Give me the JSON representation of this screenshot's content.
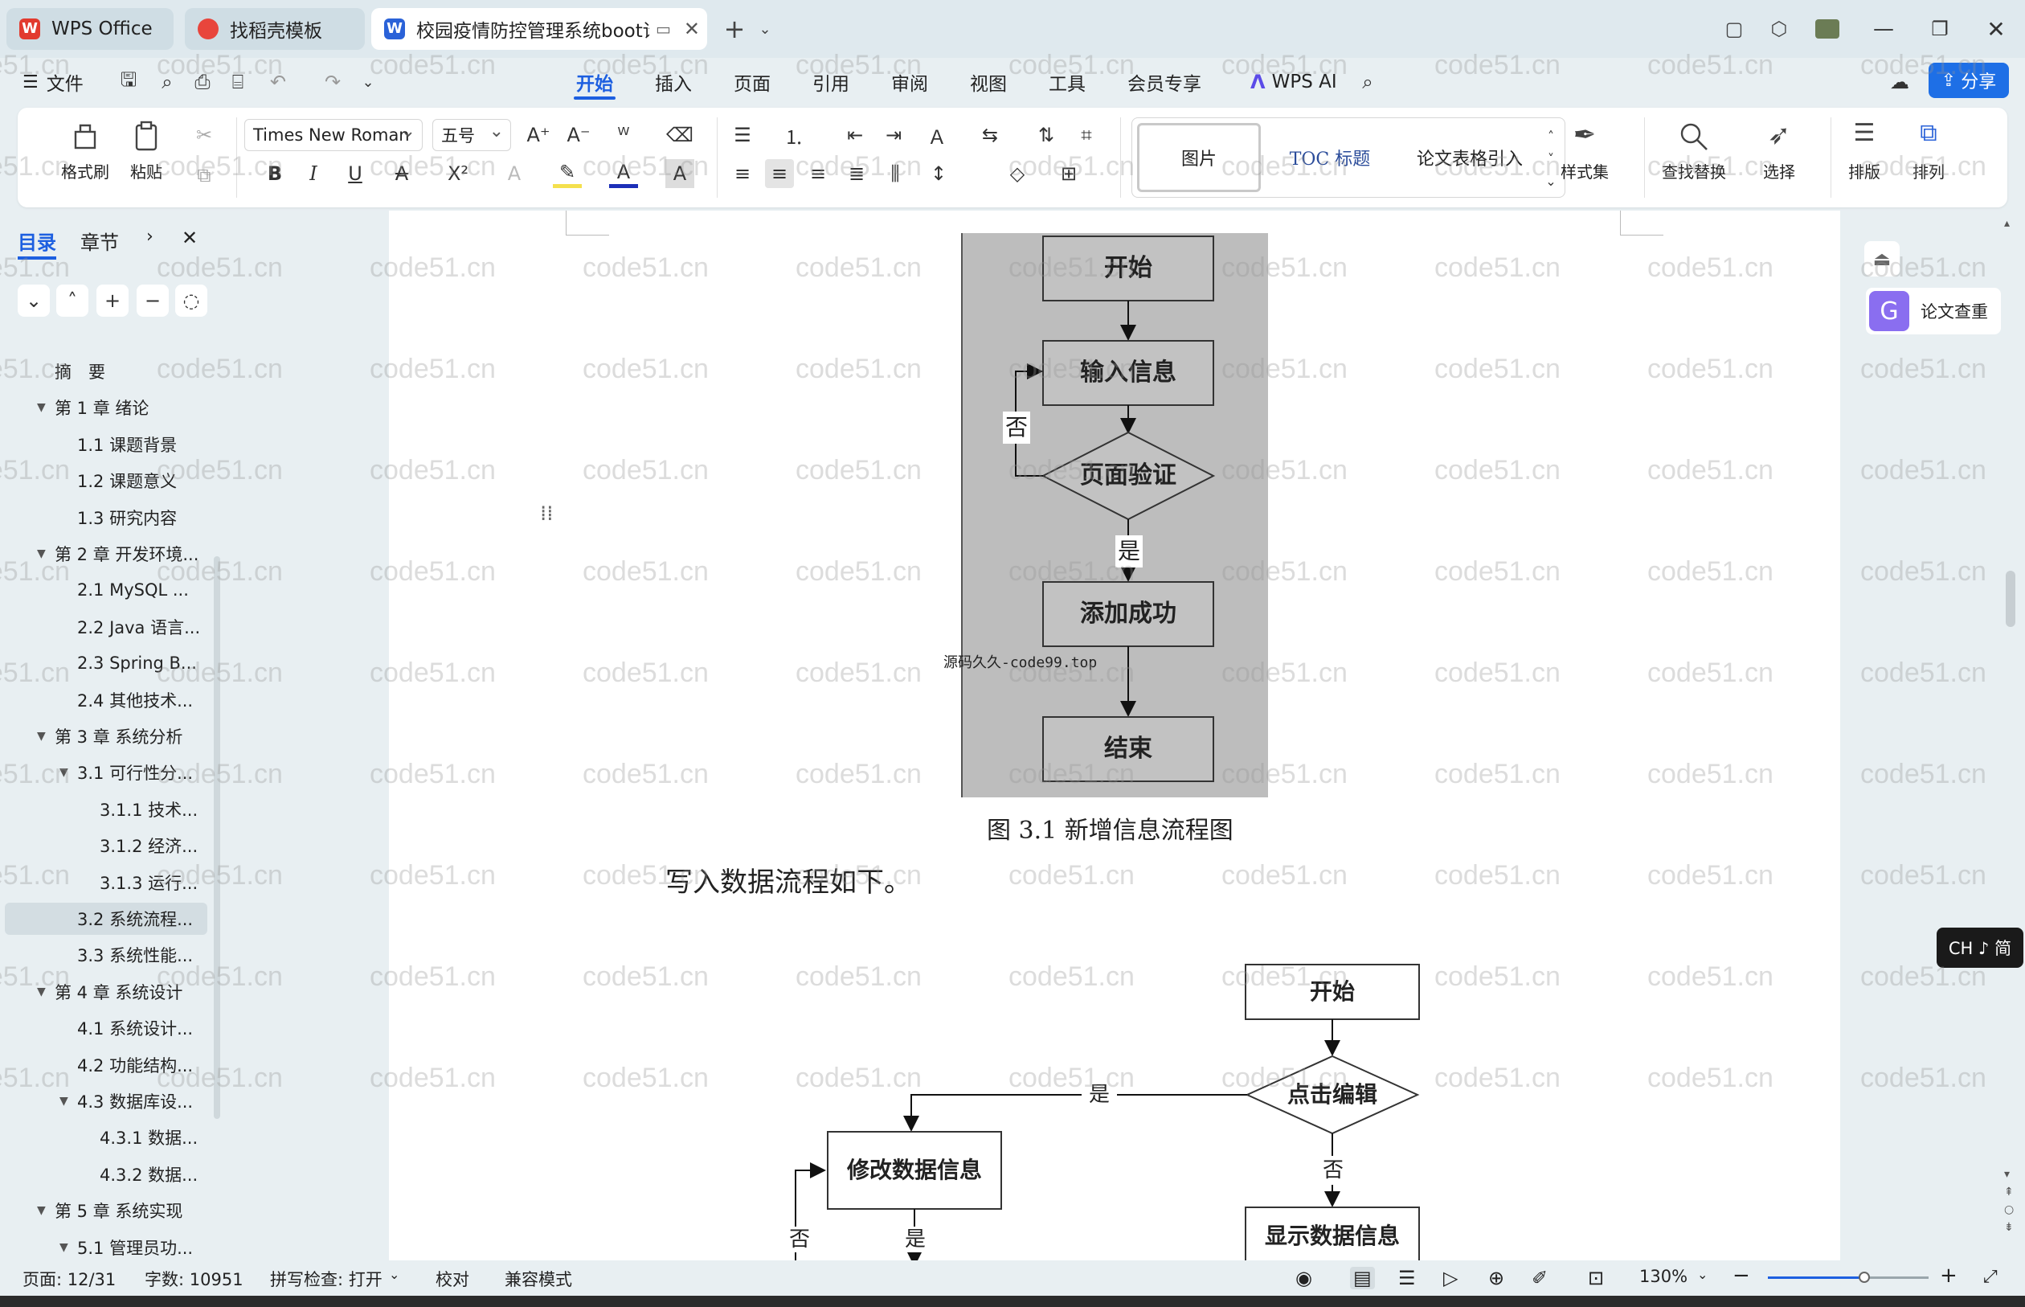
{
  "tabs": {
    "wps": "WPS Office",
    "template": "找稻壳模板",
    "document": "校园疫情防控管理系统boot论"
  },
  "menu": {
    "file": "文件",
    "home": "开始",
    "insert": "插入",
    "page": "页面",
    "reference": "引用",
    "review": "审阅",
    "view": "视图",
    "tools": "工具",
    "member": "会员专享",
    "ai": "WPS AI",
    "share": "分享"
  },
  "ribbon": {
    "format_painter": "格式刷",
    "paste": "粘贴",
    "font_name": "Times New Roman",
    "font_size": "五号",
    "style_picture": "图片",
    "style_toc": "TOC 标题",
    "style_paper": "论文表格引入",
    "style_set": "样式集",
    "find_replace": "查找替换",
    "select": "选择",
    "layout": "排版",
    "arrange": "排列"
  },
  "nav": {
    "tab_toc": "目录",
    "tab_chapter": "章节",
    "items": [
      {
        "label": "摘　要"
      },
      {
        "label": "第 1 章  绪论"
      },
      {
        "label": "1.1  课题背景"
      },
      {
        "label": "1.2  课题意义"
      },
      {
        "label": "1.3  研究内容"
      },
      {
        "label": "第 2 章  开发环境..."
      },
      {
        "label": "2.1  MySQL ..."
      },
      {
        "label": "2.2 Java 语言..."
      },
      {
        "label": "2.3 Spring B..."
      },
      {
        "label": "2.4  其他技术..."
      },
      {
        "label": "第 3 章  系统分析"
      },
      {
        "label": "3.1 可行性分..."
      },
      {
        "label": "3.1.1 技术..."
      },
      {
        "label": "3.1.2 经济..."
      },
      {
        "label": "3.1.3 运行..."
      },
      {
        "label": "3.2 系统流程..."
      },
      {
        "label": "3.3 系统性能..."
      },
      {
        "label": "第 4 章  系统设计"
      },
      {
        "label": "4.1  系统设计..."
      },
      {
        "label": "4.2  功能结构..."
      },
      {
        "label": "4.3  数据库设..."
      },
      {
        "label": "4.3.1  数据..."
      },
      {
        "label": "4.3.2  数据..."
      },
      {
        "label": "第 5 章  系统实现"
      },
      {
        "label": "5.1  管理员功..."
      }
    ]
  },
  "document": {
    "flow1": {
      "start": "开始",
      "input": "输入信息",
      "verify": "页面验证",
      "no": "否",
      "yes": "是",
      "success": "添加成功",
      "end": "结束",
      "watermark": "源码久久-code99.top"
    },
    "caption": "图 3.1  新增信息流程图",
    "body_text": "写入数据流程如下。",
    "flow2": {
      "start": "开始",
      "click_edit": "点击编辑",
      "yes": "是",
      "no": "否",
      "modify": "修改数据信息",
      "display": "显示数据信息",
      "no2": "否",
      "yes2": "是"
    }
  },
  "right_panel": {
    "plagiarism": "论文查重",
    "ime": "CH ♪ 简"
  },
  "status": {
    "page": "页面: 12/31",
    "words": "字数: 10951",
    "spell": "拼写检查: 打开",
    "proof": "校对",
    "compat": "兼容模式",
    "zoom": "130%",
    "zoom_level": 0.6
  },
  "watermark": {
    "text": "code51.cn"
  },
  "colors": {
    "accent": "#1d5fe0",
    "flow_bg": "#bdbdbd",
    "wps_red": "#e23a2e"
  }
}
